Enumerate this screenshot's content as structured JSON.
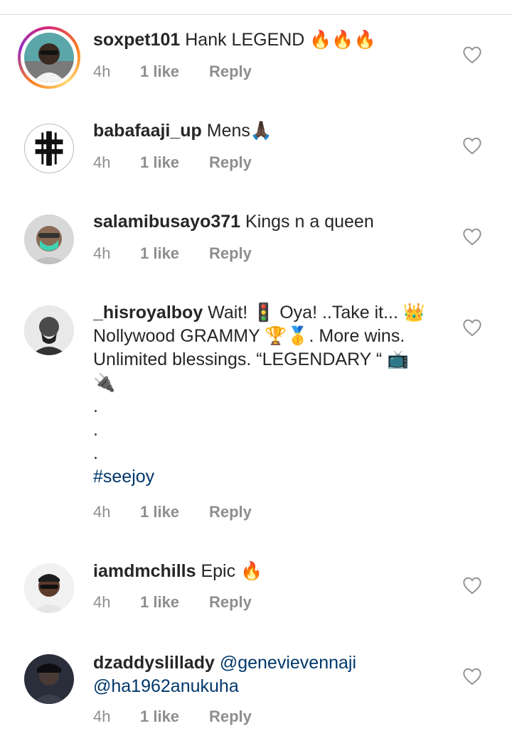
{
  "comments": [
    {
      "username": "soxpet101",
      "text": " Hank LEGEND 🔥🔥🔥",
      "time": "4h",
      "likes": "1 like",
      "reply": "Reply"
    },
    {
      "username": "babafaaji_up",
      "text": " Mens🙏🏿",
      "time": "4h",
      "likes": "1 like",
      "reply": "Reply"
    },
    {
      "username": "salamibusayo371",
      "text": " Kings n a queen",
      "time": "4h",
      "likes": "1 like",
      "reply": "Reply"
    },
    {
      "username": "_hisroyalboy",
      "text": " Wait! 🚦 Oya! ..Take it... 👑\nNollywood GRAMMY 🏆🥇. More wins.\nUnlimited blessings. “LEGENDARY “ 📺\n🔌\n.\n.\n.\n",
      "hashtag": "#seejoy",
      "time": "4h",
      "likes": "1 like",
      "reply": "Reply"
    },
    {
      "username": "iamdmchills",
      "text": " Epic 🔥",
      "time": "4h",
      "likes": "1 like",
      "reply": "Reply"
    },
    {
      "username": "dzaddyslillady",
      "text": " ",
      "mention1": "@genevievennaji",
      "mention2": "@ha1962anukuha",
      "time": "4h",
      "likes": "1 like",
      "reply": "Reply"
    }
  ],
  "icons": {
    "like": "heart-outline-icon"
  },
  "colors": {
    "text": "#262626",
    "meta": "#8e8e8e",
    "link": "#00376b"
  }
}
